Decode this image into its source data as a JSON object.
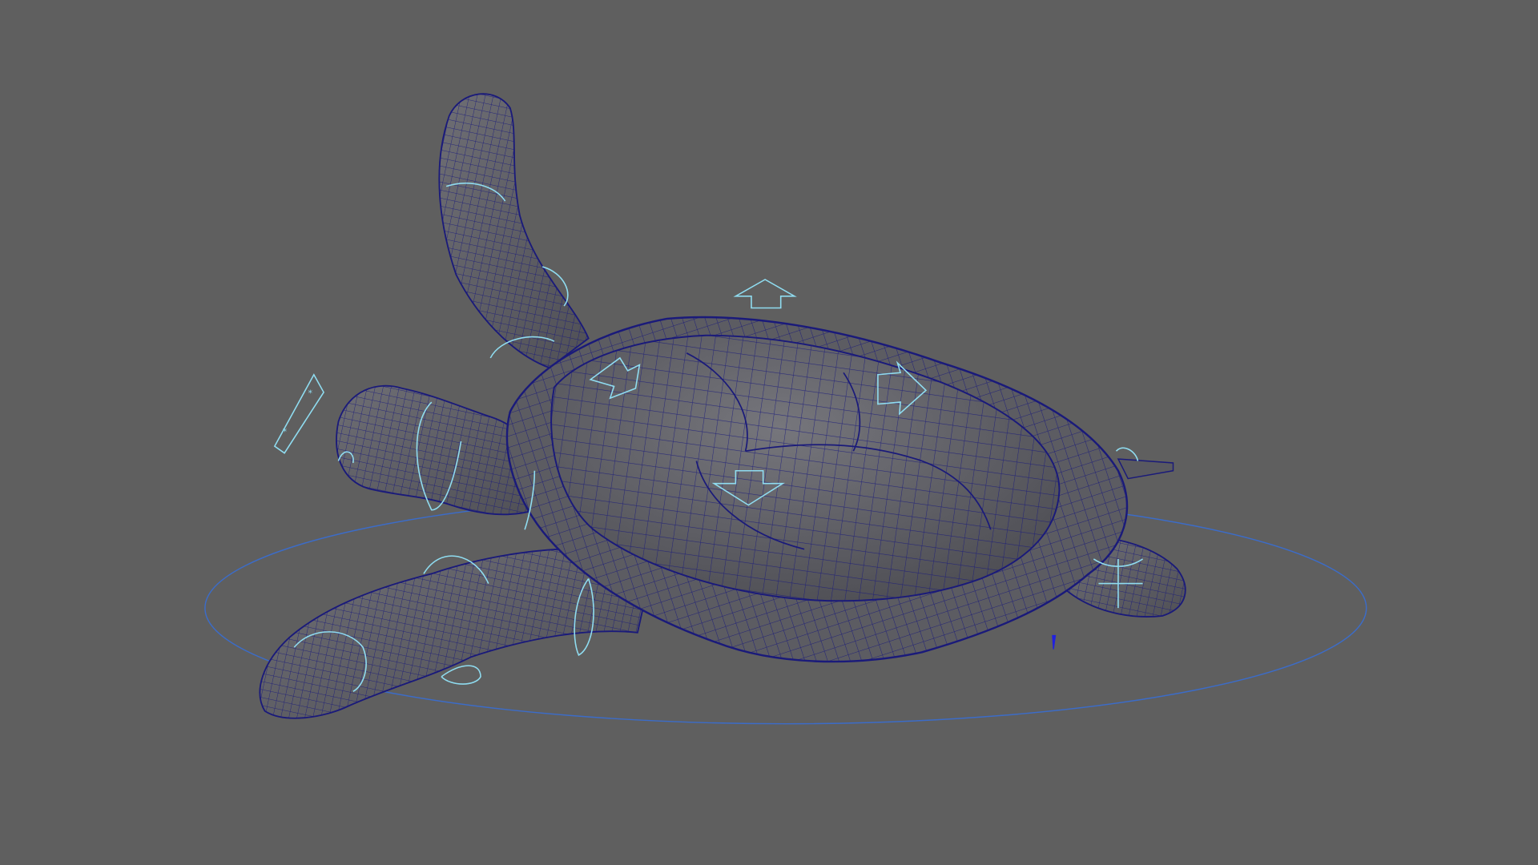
{
  "viewport": {
    "background_color": "#5f5f5f",
    "colors": {
      "mesh_fill": "#5a5a5f",
      "mesh_fill_light": "#6a6a70",
      "wire": "#1a1a7a",
      "controls": "#8fdcf0",
      "ground_ring": "#3c6cc8",
      "selection": "#2020e0"
    },
    "subject": "turtle-rig",
    "icons": [
      "turtle-mesh-icon",
      "control-curve-icon",
      "arrow-control-icon",
      "ground-ring-icon"
    ]
  }
}
